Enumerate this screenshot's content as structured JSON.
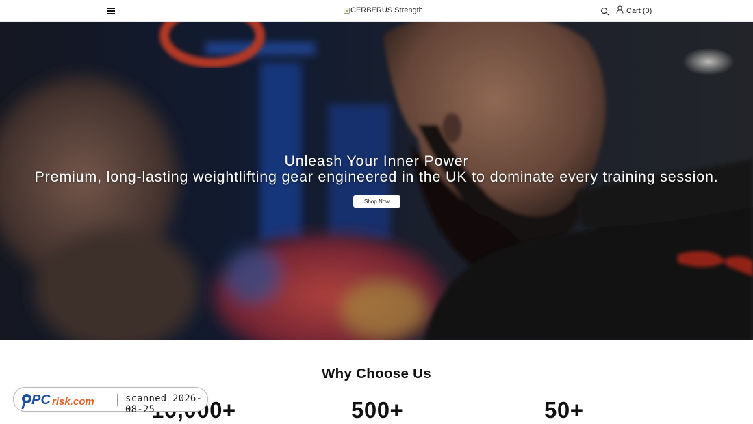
{
  "header": {
    "logo_alt": "CERBERUS Strength",
    "cart_label": "Cart (0)"
  },
  "hero": {
    "title": "Unleash Your Inner Power",
    "subtitle": "Premium, long-lasting weightlifting gear engineered in the UK to dominate every training session.",
    "cta_label": "Shop Now"
  },
  "why": {
    "title": "Why Choose Us",
    "stats": [
      "10,000+",
      "500+",
      "50+"
    ]
  },
  "badge": {
    "brand": "PCrisk.com",
    "scan_text": "scanned 2026-08-25"
  },
  "colors": {
    "hero_dark": "#0d1220",
    "accent_red": "#c8322a",
    "button_bg": "#ffffff"
  },
  "icons": [
    "menu-icon",
    "search-icon",
    "user-icon",
    "broken-image-icon"
  ]
}
